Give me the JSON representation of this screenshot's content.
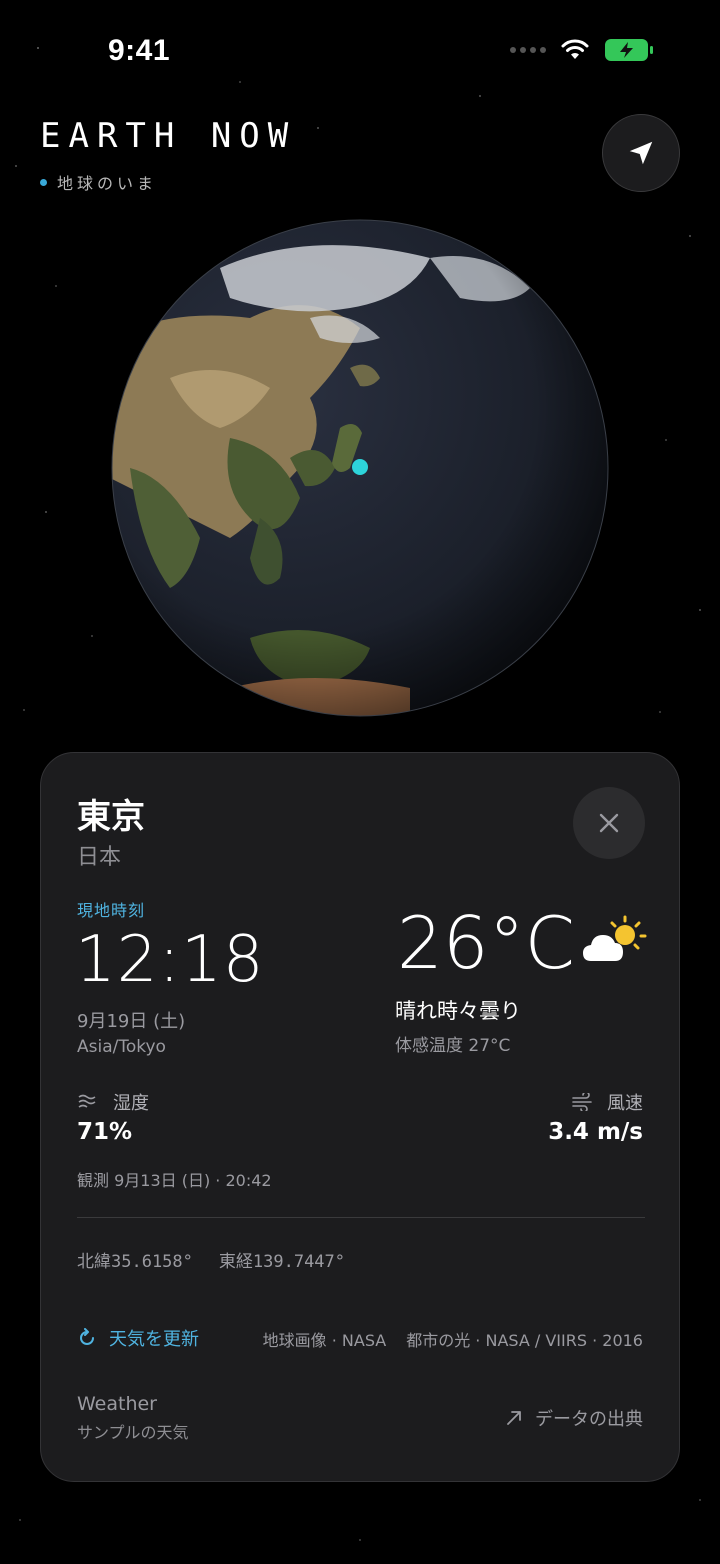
{
  "status_bar": {
    "time": "9:41"
  },
  "app": {
    "title": "EARTH NOW",
    "subtitle": "地球のいま"
  },
  "card": {
    "city": "東京",
    "country": "日本",
    "local_time_label": "現地時刻",
    "local_time": "12:18",
    "date": "9月19日 (土)",
    "timezone": "Asia/Tokyo",
    "temperature": "26°C",
    "condition": "晴れ時々曇り",
    "feels_like": "体感温度 27°C",
    "humidity_label": "湿度",
    "humidity_value": "71%",
    "wind_label": "風速",
    "wind_value": "3.4 m/s",
    "observed": "観測 9月13日 (日) · 20:42",
    "latitude": "北緯35.6158°",
    "longitude": "東経139.7447°",
    "refresh_label": "天気を更新",
    "credit_earth": "地球画像 · NASA",
    "credit_lights": "都市の光 · NASA / VIIRS · 2016",
    "weather_source_title": "Weather",
    "weather_source_sub": "サンプルの天気",
    "data_source_label": "データの出典"
  },
  "icons": {
    "locate": "location-arrow-icon",
    "close": "close-icon",
    "weather": "partly-sunny-icon",
    "humidity": "humidity-icon",
    "wind": "wind-icon",
    "refresh": "refresh-icon",
    "external": "external-link-icon"
  },
  "colors": {
    "accent": "#4fb3e0",
    "marker": "#2dd4da",
    "card_bg": "#1c1c1e",
    "battery": "#34c759"
  }
}
